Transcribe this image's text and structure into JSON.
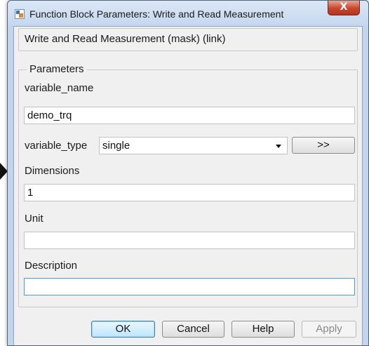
{
  "window": {
    "title": "Function Block Parameters: Write and Read Measurement",
    "close_label": "X"
  },
  "mask": {
    "title": "Write and Read Measurement (mask) (link)"
  },
  "parameters": {
    "group_label": "Parameters",
    "variable_name": {
      "label": "variable_name",
      "value": "demo_trq"
    },
    "variable_type": {
      "label": "variable_type",
      "value": "single",
      "browse_label": ">>"
    },
    "dimensions": {
      "label": "Dimensions",
      "value": "1"
    },
    "unit": {
      "label": "Unit",
      "value": ""
    },
    "description": {
      "label": "Description",
      "value": ""
    }
  },
  "buttons": {
    "ok": "OK",
    "cancel": "Cancel",
    "help": "Help",
    "apply": "Apply"
  },
  "colors": {
    "window_frame": "#c3d5ec",
    "client_bg": "#f0f0f0",
    "close_red": "#c7462c",
    "focus_blue": "#4f9bd6"
  }
}
